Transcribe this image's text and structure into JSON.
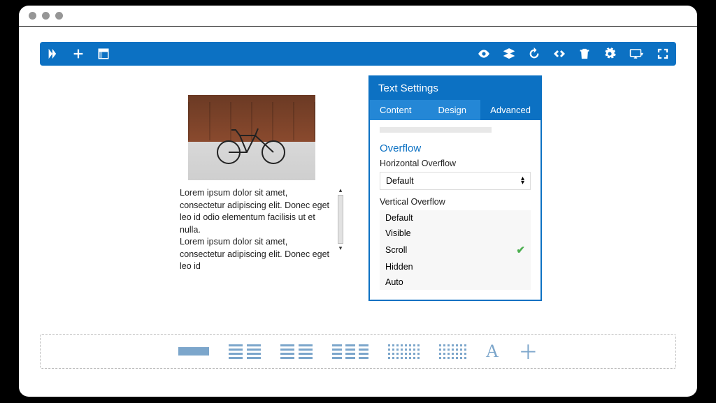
{
  "panel": {
    "title": "Text Settings",
    "tabs": {
      "content": "Content",
      "design": "Design",
      "advanced": "Advanced",
      "active": "Advanced"
    },
    "section": "Overflow",
    "horizontal": {
      "label": "Horizontal Overflow",
      "value": "Default"
    },
    "vertical": {
      "label": "Vertical Overflow",
      "options": [
        "Default",
        "Visible",
        "Scroll",
        "Hidden",
        "Auto"
      ],
      "selected": "Scroll"
    }
  },
  "text": {
    "p1": "Lorem ipsum dolor sit amet, consectetur adipiscing elit. Donec eget leo id odio elementum facilisis ut et nulla.",
    "p2": "Lorem ipsum dolor sit amet, consectetur adipiscing elit. Donec eget leo id"
  }
}
